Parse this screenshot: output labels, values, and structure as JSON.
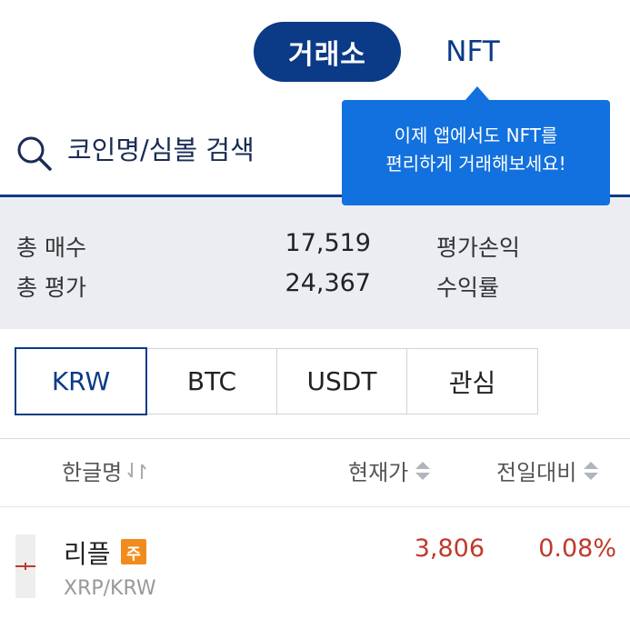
{
  "top_tabs": {
    "exchange_label": "거래소",
    "nft_label": "NFT"
  },
  "tooltip": {
    "line1": "이제 앱에서도 NFT를",
    "line2": "편리하게 거래해보세요!"
  },
  "search": {
    "placeholder": "코인명/심볼 검색"
  },
  "summary": {
    "total_buy_label": "총 매수",
    "total_buy_value": "17,519",
    "total_eval_label": "총 평가",
    "total_eval_value": "24,367",
    "pnl_label": "평가손익",
    "yield_label": "수익률"
  },
  "market_tabs": [
    {
      "label": "KRW",
      "active": true
    },
    {
      "label": "BTC",
      "active": false
    },
    {
      "label": "USDT",
      "active": false
    },
    {
      "label": "관심",
      "active": false
    }
  ],
  "list_header": {
    "name": "한글명",
    "price": "현재가",
    "change": "전일대비"
  },
  "rows": [
    {
      "name": "리플",
      "badge": "주",
      "pair": "XRP/KRW",
      "price": "3,806",
      "change": "0.08%"
    }
  ],
  "colors": {
    "brand_navy": "#0b3a87",
    "tooltip_blue": "#1271de",
    "rise_red": "#c0392b",
    "badge_orange": "#f08c1e"
  },
  "icons": [
    "search-icon",
    "swap-arrows-icon",
    "sort-updown-icon",
    "candle-icon"
  ]
}
